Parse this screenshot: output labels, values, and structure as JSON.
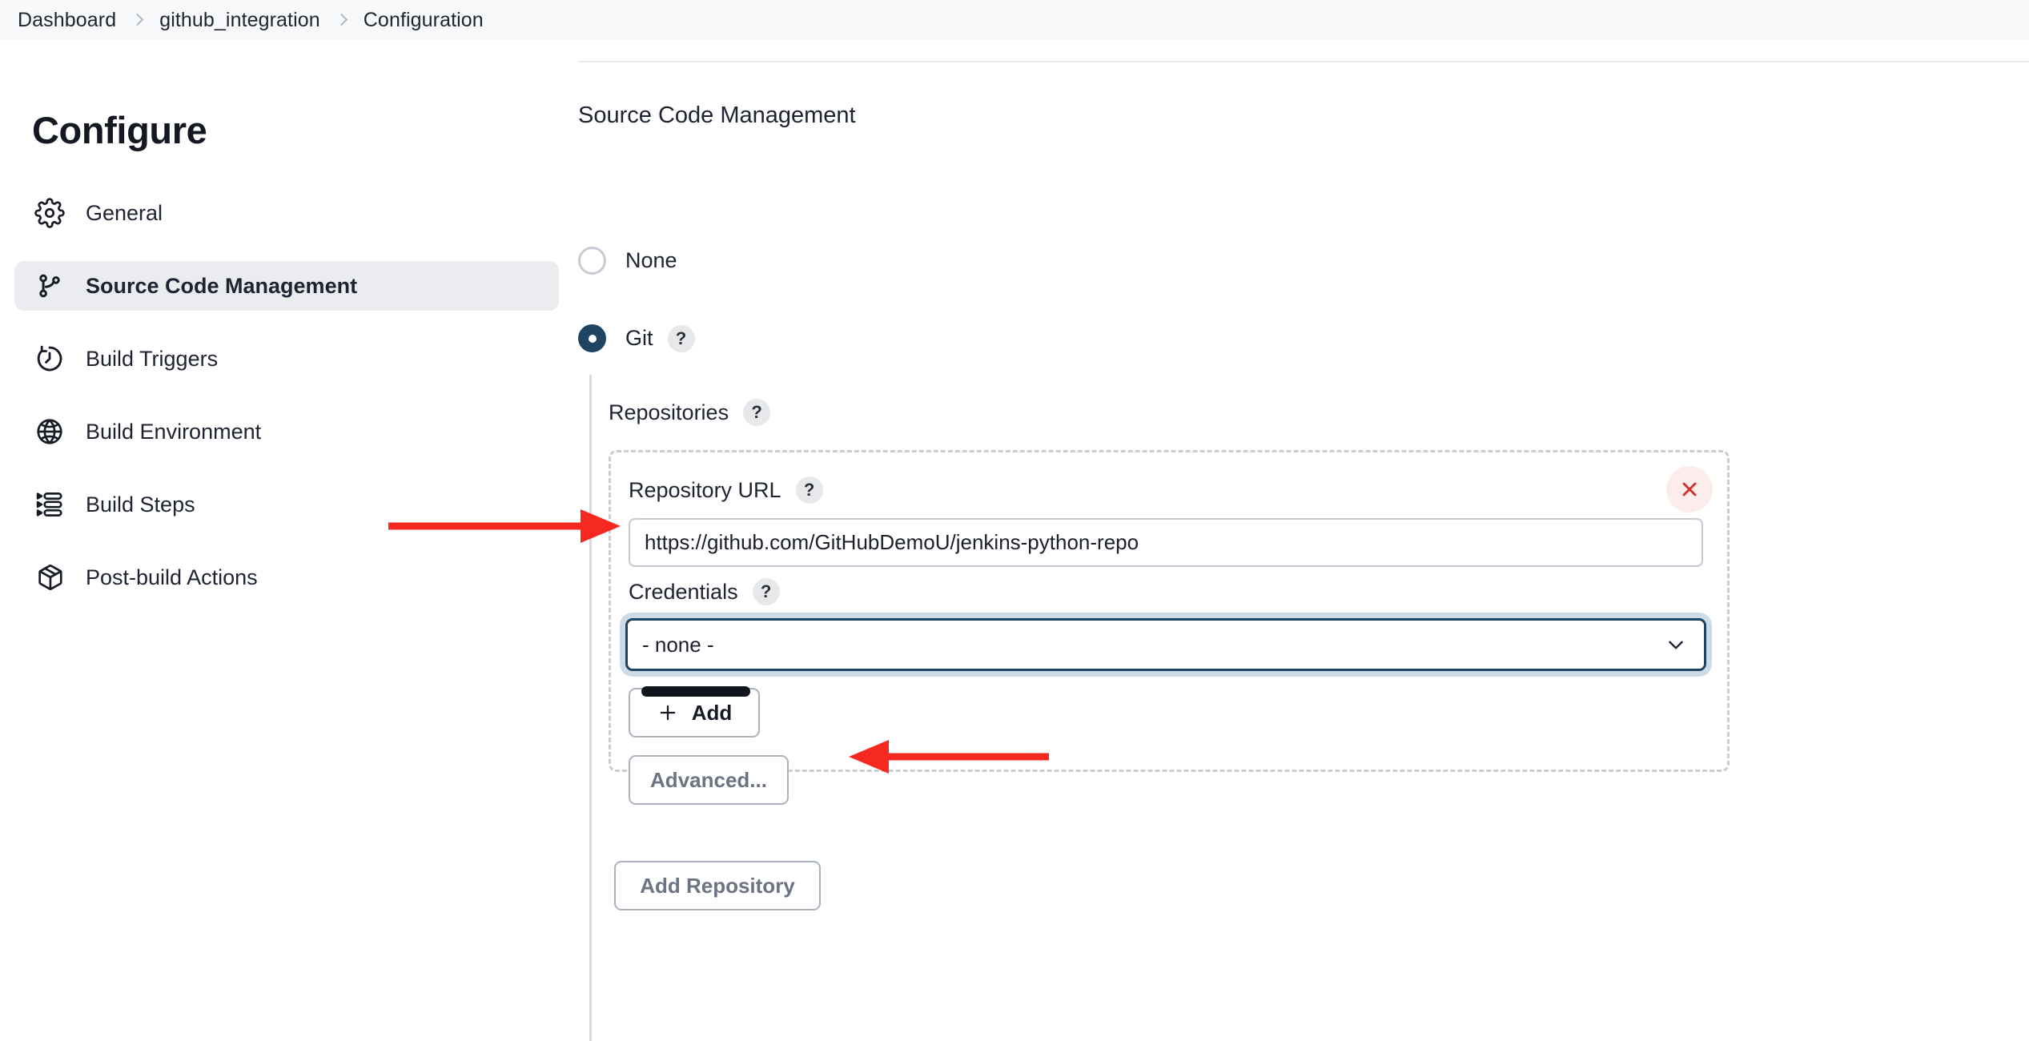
{
  "breadcrumb": {
    "items": [
      {
        "label": "Dashboard"
      },
      {
        "label": "github_integration"
      },
      {
        "label": "Configuration"
      }
    ]
  },
  "sidebar": {
    "title": "Configure",
    "items": [
      {
        "label": "General",
        "icon": "gear-icon",
        "selected": false
      },
      {
        "label": "Source Code Management",
        "icon": "git-branch-icon",
        "selected": true
      },
      {
        "label": "Build Triggers",
        "icon": "clock-icon",
        "selected": false
      },
      {
        "label": "Build Environment",
        "icon": "globe-icon",
        "selected": false
      },
      {
        "label": "Build Steps",
        "icon": "list-steps-icon",
        "selected": false
      },
      {
        "label": "Post-build Actions",
        "icon": "package-icon",
        "selected": false
      }
    ]
  },
  "main": {
    "section_title": "Source Code Management",
    "scm_options": [
      {
        "label": "None",
        "selected": false
      },
      {
        "label": "Git",
        "selected": true,
        "help": "?"
      }
    ],
    "repositories": {
      "label": "Repositories",
      "help": "?",
      "repository": {
        "url_label": "Repository URL",
        "url_help": "?",
        "url_value": "https://github.com/GitHubDemoU/jenkins-python-repo",
        "url_placeholder": "",
        "credentials_label": "Credentials",
        "credentials_help": "?",
        "credentials_value": "- none -",
        "credentials_options": [
          "- none -"
        ],
        "add_label": "Add",
        "advanced_label": "Advanced...",
        "delete_icon": "close-icon"
      },
      "add_repository_label": "Add Repository"
    }
  },
  "annotations": {
    "arrow_color": "#f5291f",
    "arrows": [
      {
        "name": "arrow-to-repository-url"
      },
      {
        "name": "arrow-to-add-button"
      }
    ]
  }
}
